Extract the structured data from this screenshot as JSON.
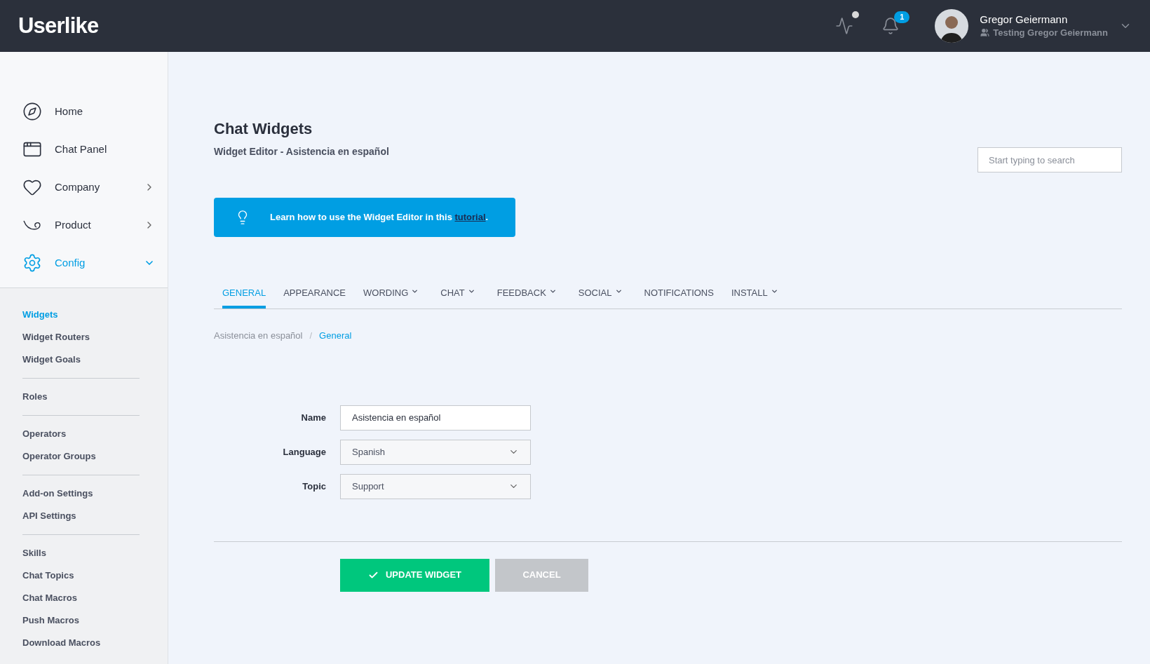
{
  "header": {
    "logo": "Userlike",
    "notifications_badge": "1",
    "user": {
      "name": "Gregor Geiermann",
      "subtitle": "Testing Gregor Geiermann"
    }
  },
  "sidebar": {
    "nav": [
      {
        "label": "Home",
        "kind": "link",
        "selected": false
      },
      {
        "label": "Chat Panel",
        "kind": "link",
        "selected": false
      },
      {
        "label": "Company",
        "kind": "group",
        "expanded": false,
        "selected": false
      },
      {
        "label": "Product",
        "kind": "group",
        "expanded": false,
        "selected": false
      },
      {
        "label": "Config",
        "kind": "group",
        "expanded": true,
        "selected": true
      }
    ],
    "sections": [
      {
        "items": [
          {
            "label": "Widgets",
            "selected": true
          },
          {
            "label": "Widget Routers",
            "selected": false
          },
          {
            "label": "Widget Goals",
            "selected": false
          }
        ]
      },
      {
        "items": [
          {
            "label": "Roles",
            "selected": false
          }
        ]
      },
      {
        "items": [
          {
            "label": "Operators",
            "selected": false
          },
          {
            "label": "Operator Groups",
            "selected": false
          }
        ]
      },
      {
        "items": [
          {
            "label": "Add-on Settings",
            "selected": false
          },
          {
            "label": "API Settings",
            "selected": false
          }
        ]
      },
      {
        "items": [
          {
            "label": "Skills",
            "selected": false
          },
          {
            "label": "Chat Topics",
            "selected": false
          },
          {
            "label": "Chat Macros",
            "selected": false
          },
          {
            "label": "Push Macros",
            "selected": false
          },
          {
            "label": "Download Macros",
            "selected": false
          }
        ]
      }
    ]
  },
  "page": {
    "title": "Chat Widgets",
    "subtitle": "Widget Editor - Asistencia en español",
    "search": {
      "placeholder": "Start typing to search"
    },
    "banner": {
      "text": "Learn how to use the Widget Editor in this ",
      "link": "tutorial",
      "end": "."
    }
  },
  "tabs": [
    {
      "label": "GENERAL",
      "selected": true,
      "kind": "plain"
    },
    {
      "label": "APPEARANCE",
      "selected": false,
      "kind": "plain"
    },
    {
      "label": "WORDING",
      "selected": false,
      "kind": "menu"
    },
    {
      "label": "CHAT",
      "selected": false,
      "kind": "menu"
    },
    {
      "label": "FEEDBACK",
      "selected": false,
      "kind": "menu"
    },
    {
      "label": "SOCIAL",
      "selected": false,
      "kind": "menu"
    },
    {
      "label": "NOTIFICATIONS",
      "selected": false,
      "kind": "plain"
    },
    {
      "label": "INSTALL",
      "selected": false,
      "kind": "menu"
    }
  ],
  "breadcrumb_separator": "/",
  "breadcrumb": [
    {
      "label": "Asistencia en español",
      "selected": false
    },
    {
      "label": "General",
      "selected": true
    }
  ],
  "form": {
    "fields": [
      {
        "label": "Name",
        "kind": "text",
        "value": "Asistencia en español"
      },
      {
        "label": "Language",
        "kind": "select",
        "value": "Spanish"
      },
      {
        "label": "Topic",
        "kind": "select",
        "value": "Support"
      }
    ],
    "buttons": [
      {
        "label": "UPDATE WIDGET",
        "kind": "primary"
      },
      {
        "label": "CANCEL",
        "kind": "secondary"
      }
    ]
  }
}
